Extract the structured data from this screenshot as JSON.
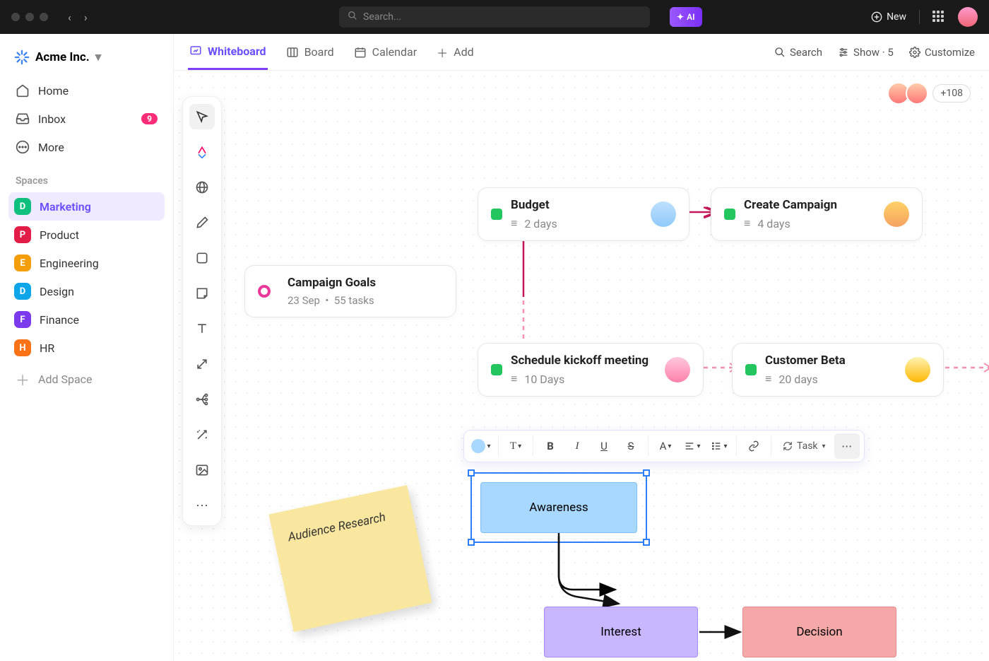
{
  "titlebar": {
    "search_placeholder": "Search...",
    "ai_label": "AI",
    "new_label": "New"
  },
  "workspace": {
    "name": "Acme Inc."
  },
  "sidebar": {
    "nav": [
      {
        "label": "Home"
      },
      {
        "label": "Inbox",
        "badge": "9"
      },
      {
        "label": "More"
      }
    ],
    "section_label": "Spaces",
    "spaces": [
      {
        "letter": "D",
        "label": "Marketing",
        "color": "#0fbf7e"
      },
      {
        "letter": "P",
        "label": "Product",
        "color": "#e11d48"
      },
      {
        "letter": "E",
        "label": "Engineering",
        "color": "#f59e0b"
      },
      {
        "letter": "D",
        "label": "Design",
        "color": "#0ea5e9"
      },
      {
        "letter": "F",
        "label": "Finance",
        "color": "#7c3aed"
      },
      {
        "letter": "H",
        "label": "HR",
        "color": "#f97316"
      }
    ],
    "add_space_label": "Add Space"
  },
  "views": {
    "tabs": [
      {
        "label": "Whiteboard"
      },
      {
        "label": "Board"
      },
      {
        "label": "Calendar"
      },
      {
        "label": "Add"
      }
    ],
    "right": {
      "search": "Search",
      "show": "Show · 5",
      "customize": "Customize"
    }
  },
  "collaborators": {
    "more_count": "+108"
  },
  "cards": {
    "goals": {
      "title": "Campaign Goals",
      "date": "23 Sep",
      "tasks": "55 tasks"
    },
    "budget": {
      "title": "Budget",
      "duration": "2 days"
    },
    "create": {
      "title": "Create Campaign",
      "duration": "4 days"
    },
    "kickoff": {
      "title": "Schedule kickoff meeting",
      "duration": "10 Days"
    },
    "beta": {
      "title": "Customer Beta",
      "duration": "20 days"
    }
  },
  "sticky": {
    "text": "Audience Research"
  },
  "shapes": {
    "awareness": "Awareness",
    "interest": "Interest",
    "decision": "Decision"
  },
  "format_toolbar": {
    "task_label": "Task"
  },
  "colors": {
    "accent": "#7b3ff7",
    "pink": "#e8399a",
    "green_status": "#22c55e"
  }
}
